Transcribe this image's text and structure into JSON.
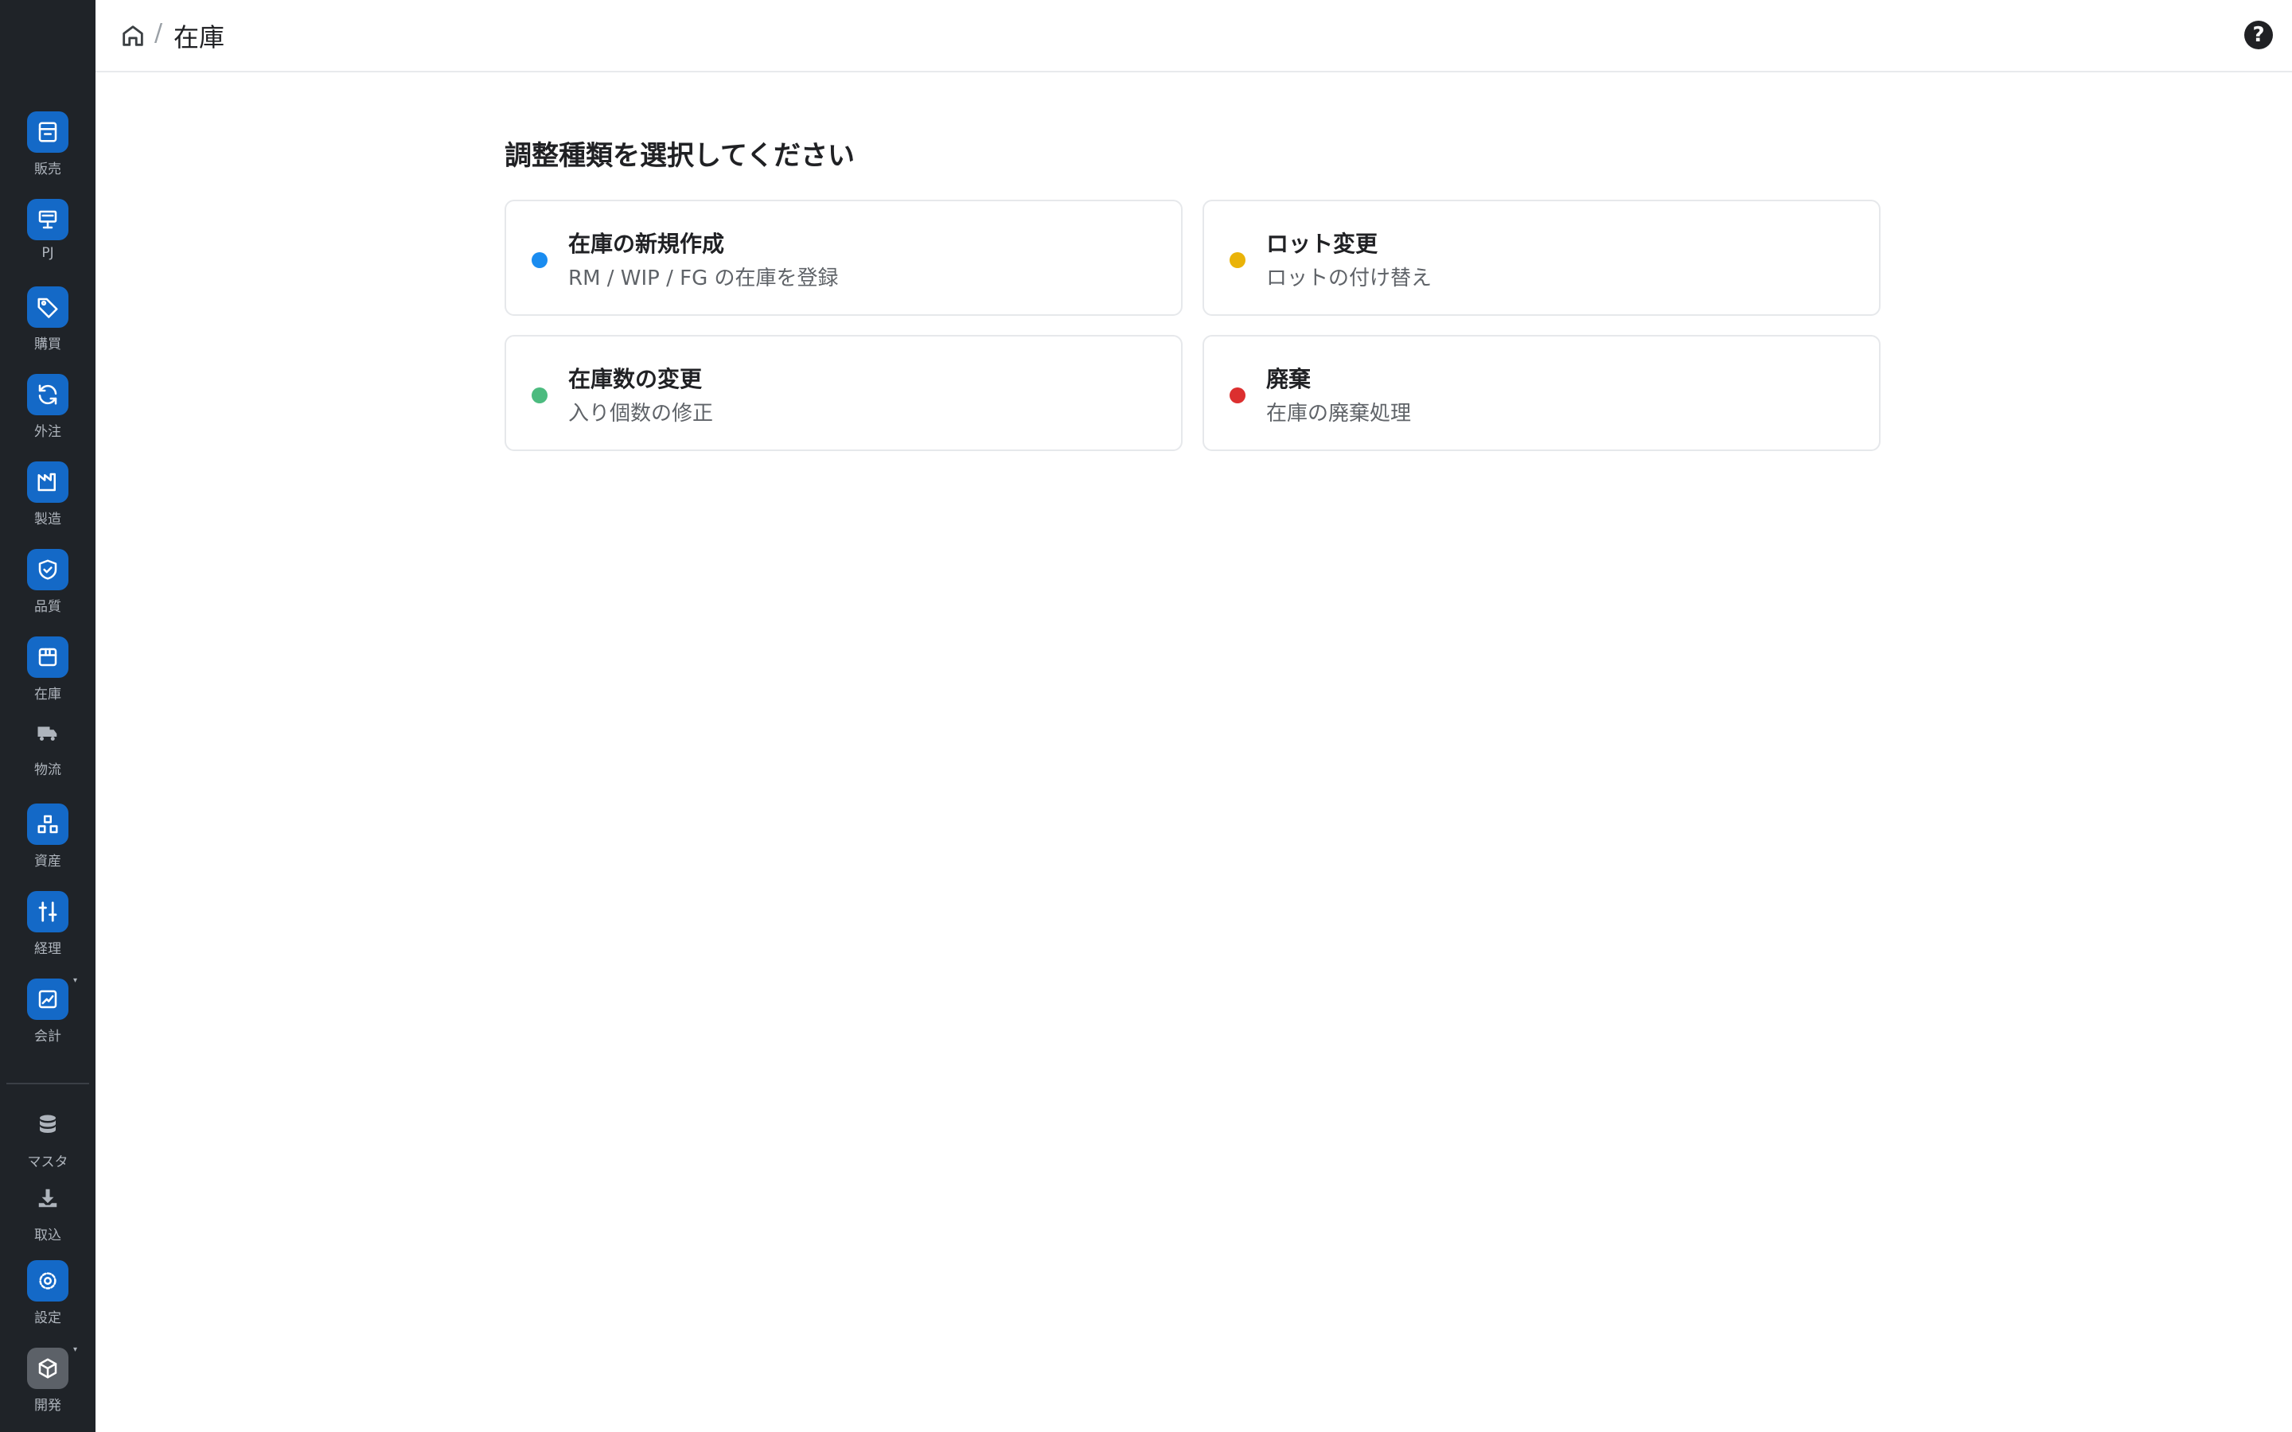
{
  "colors": {
    "sidebar_bg": "#1f2328",
    "nav_icon_bg": "#1469c7",
    "dot_blue": "#1a8cf0",
    "dot_yellow": "#eab308",
    "dot_green": "#4cbb7f",
    "dot_red": "#dc2f2f"
  },
  "sidebar": {
    "items": [
      {
        "label": "販売",
        "icon": "store-icon"
      },
      {
        "label": "PJ",
        "icon": "presentation-icon"
      },
      {
        "label": "購買",
        "icon": "tag-icon"
      },
      {
        "label": "外注",
        "icon": "refresh-icon"
      },
      {
        "label": "製造",
        "icon": "factory-icon"
      },
      {
        "label": "品質",
        "icon": "shield-check-icon"
      },
      {
        "label": "在庫",
        "icon": "box-icon"
      },
      {
        "label": "物流",
        "icon": "truck-icon"
      },
      {
        "label": "資産",
        "icon": "boxes-icon"
      },
      {
        "label": "経理",
        "icon": "sliders-icon"
      },
      {
        "label": "会計",
        "icon": "chart-icon"
      },
      {
        "label": "マスタ",
        "icon": "database-icon"
      },
      {
        "label": "取込",
        "icon": "download-icon"
      },
      {
        "label": "設定",
        "icon": "gear-icon"
      },
      {
        "label": "開発",
        "icon": "cube-icon"
      }
    ]
  },
  "header": {
    "separator": "/",
    "current": "在庫",
    "help": "?"
  },
  "main": {
    "title": "調整種類を選択してください",
    "options": [
      {
        "title": "在庫の新規作成",
        "description": "RM / WIP / FG の在庫を登録"
      },
      {
        "title": "ロット変更",
        "description": "ロットの付け替え"
      },
      {
        "title": "在庫数の変更",
        "description": "入り個数の修正"
      },
      {
        "title": "廃棄",
        "description": "在庫の廃棄処理"
      }
    ]
  }
}
